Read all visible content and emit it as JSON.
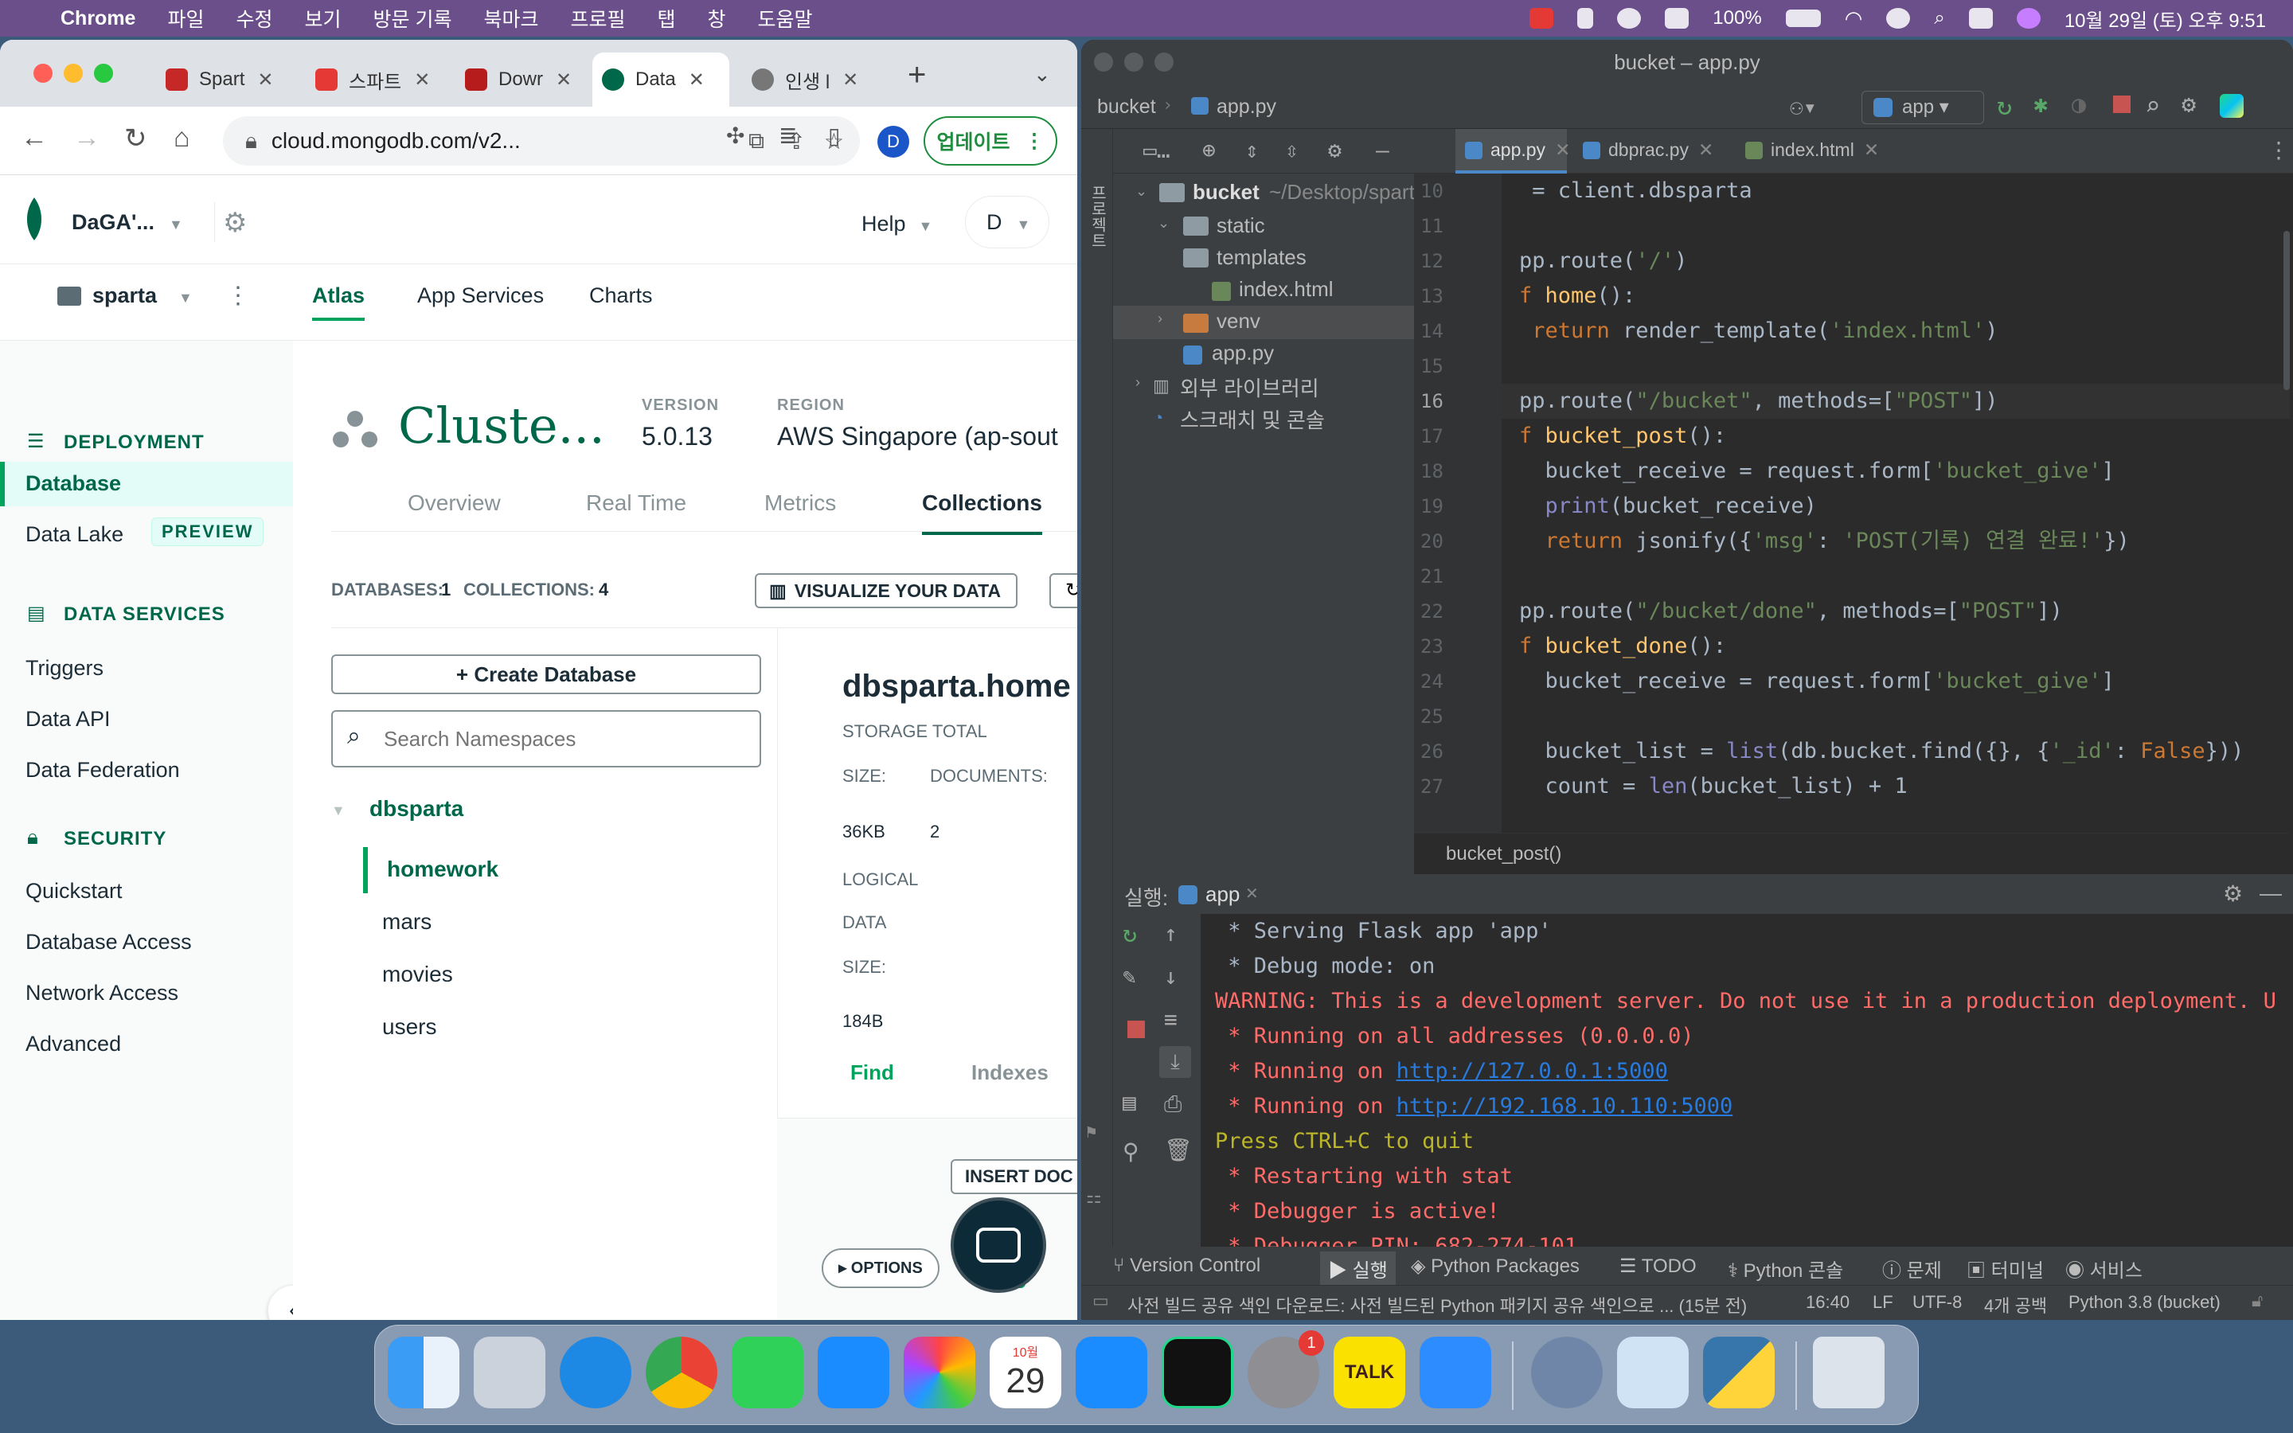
{
  "menubar": {
    "app": "Chrome",
    "items": [
      "파일",
      "수정",
      "보기",
      "방문 기록",
      "북마크",
      "프로필",
      "탭",
      "창",
      "도움말"
    ],
    "battery": "100%",
    "datetime": "10월 29일 (토) 오후 9:51"
  },
  "chrome": {
    "tabs": [
      {
        "label": "Spart",
        "color": "#c62828"
      },
      {
        "label": "스파트",
        "color": "#e53935"
      },
      {
        "label": "Dowr",
        "color": "#b71c1c"
      },
      {
        "label": "Data",
        "color": "#00684a"
      },
      {
        "label": "인생 l",
        "color": "#777777"
      }
    ],
    "url": "cloud.mongodb.com/v2...",
    "update_label": "업데이트",
    "profile_initial": "D"
  },
  "atlas": {
    "org": "DaGA'...",
    "help": "Help",
    "user": "D",
    "project": "sparta",
    "nav_tabs": [
      "Atlas",
      "App Services",
      "Charts"
    ],
    "sidebar": {
      "deployment_header": "DEPLOYMENT",
      "database": "Database",
      "data_lake": "Data Lake",
      "preview_badge": "PREVIEW",
      "data_services_header": "DATA SERVICES",
      "triggers": "Triggers",
      "data_api": "Data API",
      "data_federation": "Data Federation",
      "security_header": "SECURITY",
      "quickstart": "Quickstart",
      "database_access": "Database Access",
      "network_access": "Network Access",
      "advanced": "Advanced"
    },
    "cluster": {
      "name": "Cluste...",
      "version_label": "VERSION",
      "version": "5.0.13",
      "region_label": "REGION",
      "region": "AWS Singapore (ap-sout"
    },
    "cluster_tabs": [
      "Overview",
      "Real Time",
      "Metrics",
      "Collections"
    ],
    "databases_label": "DATABASES:",
    "databases_count": "1",
    "collections_label": "COLLECTIONS:",
    "collections_count": "4",
    "visualize_btn": "VISUALIZE YOUR DATA",
    "create_db_btn": "+ Create Database",
    "search_placeholder": "Search Namespaces",
    "db_name": "dbsparta",
    "collections": [
      "homework",
      "mars",
      "movies",
      "users"
    ],
    "detail": {
      "title": "dbsparta.home",
      "storage_label": "STORAGE TOTAL",
      "size_label": "SIZE:",
      "documents_label": "DOCUMENTS:",
      "size_value": "36KB",
      "documents_value": "2",
      "logical_label": "LOGICAL",
      "data_label": "DATA",
      "size_label2": "SIZE:",
      "logical_value": "184B",
      "find_tab": "Find",
      "indexes_tab": "Indexes",
      "insert_btn": "INSERT DOC",
      "options_btn": "OPTIONS"
    }
  },
  "pycharm": {
    "title": "bucket – app.py",
    "project": "bucket",
    "file": "app.py",
    "run_config": "app",
    "editor_tabs": [
      "app.py",
      "dbprac.py",
      "index.html"
    ],
    "project_label": "프로젝트",
    "tree": {
      "root": "bucket",
      "root_path": "~/Desktop/spart",
      "static": "static",
      "templates": "templates",
      "index_html": "index.html",
      "venv": "venv",
      "app_py": "app.py",
      "ext_libs": "외부 라이브러리",
      "scratches": "스크래치 및 콘솔"
    },
    "line_numbers": [
      "10",
      "11",
      "12",
      "13",
      "14",
      "15",
      "16",
      "17",
      "18",
      "19",
      "20",
      "21",
      "22",
      "23",
      "24",
      "25",
      "26",
      "27"
    ],
    "breadcrumb": "bucket_post()",
    "run_label": "실행:",
    "run_tab": "app",
    "bottom_tools": [
      "Version Control",
      "실행",
      "Python Packages",
      "TODO",
      "Python 콘솔",
      "문제",
      "터미널",
      "서비스"
    ],
    "status": {
      "message": "사전 빌드 공유 색인 다운로드: 사전 빌드된 Python 패키지 공유 색인으로 ... (15분 전)",
      "position": "16:40",
      "lf": "LF",
      "encoding": "UTF-8",
      "indent": "4개 공백",
      "interpreter": "Python 3.8 (bucket)"
    }
  },
  "code_lines": [
    [
      {
        "t": " = client.dbsparta",
        "c": ""
      }
    ],
    [
      {
        "t": "",
        "c": ""
      }
    ],
    [
      {
        "t": "pp.route(",
        "c": ""
      },
      {
        "t": "'/'",
        "c": "str"
      },
      {
        "t": ")",
        "c": ""
      }
    ],
    [
      {
        "t": "f ",
        "c": "kw"
      },
      {
        "t": "home",
        "c": "fn"
      },
      {
        "t": "():",
        "c": ""
      }
    ],
    [
      {
        "t": " return ",
        "c": "kw"
      },
      {
        "t": "render_template(",
        "c": ""
      },
      {
        "t": "'index.html'",
        "c": "str"
      },
      {
        "t": ")",
        "c": ""
      }
    ],
    [
      {
        "t": "",
        "c": ""
      }
    ],
    [
      {
        "t": "pp.route(",
        "c": ""
      },
      {
        "t": "\"/bucket\"",
        "c": "str"
      },
      {
        "t": ", methods=[",
        "c": ""
      },
      {
        "t": "\"POST\"",
        "c": "str"
      },
      {
        "t": "])",
        "c": ""
      }
    ],
    [
      {
        "t": "f ",
        "c": "kw"
      },
      {
        "t": "bucket_post",
        "c": "fn"
      },
      {
        "t": "():",
        "c": ""
      }
    ],
    [
      {
        "t": "  bucket_receive = request.form[",
        "c": ""
      },
      {
        "t": "'bucket_give'",
        "c": "str"
      },
      {
        "t": "]",
        "c": ""
      }
    ],
    [
      {
        "t": "  ",
        "c": ""
      },
      {
        "t": "print",
        "c": "py"
      },
      {
        "t": "(bucket_receive)",
        "c": ""
      }
    ],
    [
      {
        "t": "  return ",
        "c": "kw"
      },
      {
        "t": "jsonify({",
        "c": ""
      },
      {
        "t": "'msg'",
        "c": "str"
      },
      {
        "t": ": ",
        "c": ""
      },
      {
        "t": "'POST(기록) 연결 완료!'",
        "c": "str"
      },
      {
        "t": "})",
        "c": ""
      }
    ],
    [
      {
        "t": "",
        "c": ""
      }
    ],
    [
      {
        "t": "pp.route(",
        "c": ""
      },
      {
        "t": "\"/bucket/done\"",
        "c": "str"
      },
      {
        "t": ", methods=[",
        "c": ""
      },
      {
        "t": "\"POST\"",
        "c": "str"
      },
      {
        "t": "])",
        "c": ""
      }
    ],
    [
      {
        "t": "f ",
        "c": "kw"
      },
      {
        "t": "bucket_done",
        "c": "fn"
      },
      {
        "t": "():",
        "c": ""
      }
    ],
    [
      {
        "t": "  bucket_receive = request.form[",
        "c": ""
      },
      {
        "t": "'bucket_give'",
        "c": "str"
      },
      {
        "t": "]",
        "c": ""
      }
    ],
    [
      {
        "t": "",
        "c": ""
      }
    ],
    [
      {
        "t": "  bucket_list = ",
        "c": ""
      },
      {
        "t": "list",
        "c": "py"
      },
      {
        "t": "(db.bucket.find({}, {",
        "c": ""
      },
      {
        "t": "'_id'",
        "c": "str"
      },
      {
        "t": ": ",
        "c": ""
      },
      {
        "t": "False",
        "c": "kw"
      },
      {
        "t": "}))",
        "c": ""
      }
    ],
    [
      {
        "t": "  count = ",
        "c": ""
      },
      {
        "t": "len",
        "c": "py"
      },
      {
        "t": "(bucket_list) + 1",
        "c": ""
      }
    ]
  ],
  "console_lines": [
    {
      "t": " * Serving Flask app 'app'",
      "c": ""
    },
    {
      "t": " * Debug mode: on",
      "c": ""
    },
    {
      "t": "WARNING: This is a development server. Do not use it in a production deployment. U",
      "c": "red"
    },
    {
      "t": " * Running on all addresses (0.0.0.0)",
      "c": "red"
    },
    {
      "t": " * Running on http://127.0.0.1:5000",
      "c": "red"
    },
    {
      "t": " * Running on http://192.168.10.110:5000",
      "c": "red"
    },
    {
      "t": "Press CTRL+C to quit",
      "c": "yel"
    },
    {
      "t": " * Restarting with stat",
      "c": "red"
    },
    {
      "t": " * Debugger is active!",
      "c": "red"
    },
    {
      "t": " * Debugger PIN: 682-274-101",
      "c": "red"
    }
  ],
  "dock": {
    "calendar_month": "10월",
    "calendar_day": "29",
    "badge": "1",
    "talk": "TALK",
    "apps": [
      "finder",
      "launchpad",
      "safari",
      "chrome",
      "messages",
      "mail",
      "photos",
      "calendar",
      "app-store",
      "pycharm",
      "system-settings",
      "kakaotalk",
      "zoom",
      "rocket",
      "preview",
      "python",
      "trash"
    ]
  }
}
